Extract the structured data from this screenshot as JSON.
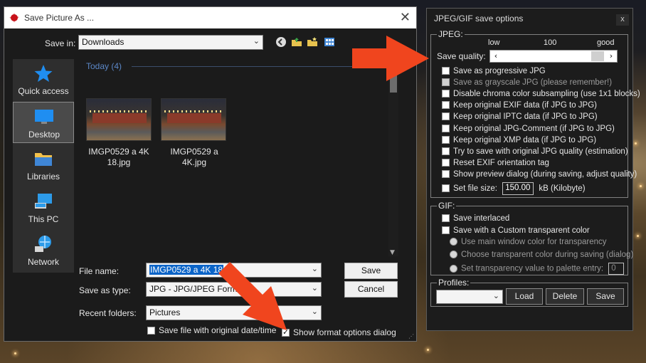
{
  "save_dialog": {
    "title": "Save Picture As ...",
    "save_in_label": "Save in:",
    "save_in_value": "Downloads",
    "group_header": "Today (4)",
    "places": [
      {
        "label": "Quick access",
        "icon": "star-icon"
      },
      {
        "label": "Desktop",
        "icon": "desktop-icon",
        "active": true
      },
      {
        "label": "Libraries",
        "icon": "libraries-icon"
      },
      {
        "label": "This PC",
        "icon": "computer-icon"
      },
      {
        "label": "Network",
        "icon": "network-icon"
      }
    ],
    "files": [
      {
        "name": "IMGP0529 a 4K 18.jpg"
      },
      {
        "name": "IMGP0529 a 4K.jpg"
      }
    ],
    "file_name_label": "File name:",
    "file_name_value": "IMGP0529 a 4K 18",
    "save_as_type_label": "Save as type:",
    "save_as_type_value": "JPG - JPG/JPEG Format",
    "recent_folders_label": "Recent folders:",
    "recent_folders_value": "Pictures",
    "save_button": "Save",
    "cancel_button": "Cancel",
    "keep_date_label": "Save file with original date/time",
    "show_format_label": "Show format options dialog"
  },
  "options_panel": {
    "title": "JPEG/GIF save options",
    "close": "x",
    "jpeg_group": "JPEG:",
    "quality_low": "low",
    "quality_mid": "100",
    "quality_high": "good",
    "quality_label": "Save quality:",
    "jpeg_options": [
      {
        "label": "Save as progressive JPG",
        "enabled": true
      },
      {
        "label": "Save as grayscale JPG (please remember!)",
        "enabled": false
      },
      {
        "label": "Disable chroma color subsampling (use 1x1 blocks)",
        "enabled": true
      },
      {
        "label": "Keep original EXIF data (if JPG to JPG)",
        "enabled": true
      },
      {
        "label": "Keep original IPTC data (if JPG to JPG)",
        "enabled": true
      },
      {
        "label": "Keep original JPG-Comment (if JPG to JPG)",
        "enabled": true
      },
      {
        "label": "Keep original XMP data (if JPG to JPG)",
        "enabled": true
      },
      {
        "label": "Try to save with original JPG quality (estimation)",
        "enabled": true
      },
      {
        "label": "Reset EXIF orientation tag",
        "enabled": true
      },
      {
        "label": "Show preview dialog (during saving, adjust quality)",
        "enabled": true
      }
    ],
    "file_size_label": "Set file size:",
    "file_size_value": "150.00",
    "file_size_unit": "kB (Kilobyte)",
    "gif_group": "GIF:",
    "save_interlaced": "Save interlaced",
    "custom_transparent": "Save with a Custom transparent color",
    "radio_main_window": "Use main window color for transparency",
    "radio_choose": "Choose transparent color during saving (dialog)",
    "radio_palette": "Set transparency value to palette entry:",
    "palette_value": "0",
    "profiles_group": "Profiles:",
    "load_button": "Load",
    "delete_button": "Delete",
    "save_button": "Save"
  },
  "colors": {
    "arrow": "#f0451e",
    "dialog_bg": "#1b1b1b",
    "accent": "#0a64c8"
  }
}
